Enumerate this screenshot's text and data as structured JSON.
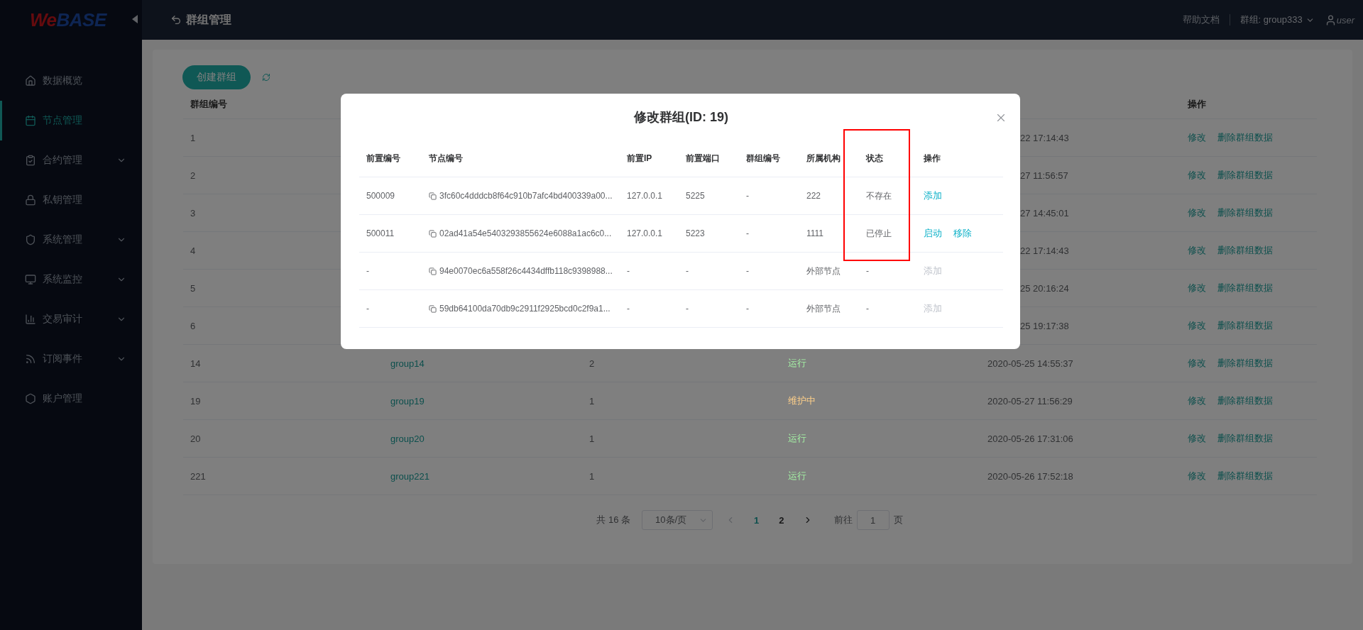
{
  "logo": [
    "We",
    "BASE"
  ],
  "sidebar": {
    "items": [
      {
        "label": "数据概览",
        "selected": false,
        "expandable": false
      },
      {
        "label": "节点管理",
        "selected": true,
        "expandable": false
      },
      {
        "label": "合约管理",
        "selected": false,
        "expandable": true
      },
      {
        "label": "私钥管理",
        "selected": false,
        "expandable": false
      },
      {
        "label": "系统管理",
        "selected": false,
        "expandable": true
      },
      {
        "label": "系统监控",
        "selected": false,
        "expandable": true
      },
      {
        "label": "交易审计",
        "selected": false,
        "expandable": true
      },
      {
        "label": "订阅事件",
        "selected": false,
        "expandable": true
      },
      {
        "label": "账户管理",
        "selected": false,
        "expandable": false
      }
    ]
  },
  "topbar": {
    "title": "群组管理",
    "help": "帮助文档",
    "group": "群组: group333",
    "user": "user"
  },
  "toolbar": {
    "create_button": "创建群组"
  },
  "table": {
    "columns": [
      "群组编号",
      null,
      null,
      null,
      null,
      "操作"
    ],
    "rows": [
      {
        "id": "1",
        "time": "22 17:14:43",
        "actions": [
          "修改",
          "删除群组数据"
        ]
      },
      {
        "id": "2",
        "time": "27 11:56:57",
        "actions": [
          "修改",
          "删除群组数据"
        ]
      },
      {
        "id": "3",
        "time": "27 14:45:01",
        "actions": [
          "修改",
          "删除群组数据"
        ]
      },
      {
        "id": "4",
        "time": "22 17:14:43",
        "actions": [
          "修改",
          "删除群组数据"
        ]
      },
      {
        "id": "5",
        "time": "25 20:16:24",
        "actions": [
          "修改",
          "删除群组数据"
        ]
      },
      {
        "id": "6",
        "time": "25 19:17:38",
        "actions": [
          "修改",
          "删除群组数据"
        ]
      },
      {
        "id": "14",
        "name": "group14",
        "nodes": "2",
        "status": "运行",
        "color": "#a4f0a4",
        "time": "2020-05-25 14:55:37",
        "actions": [
          "修改",
          "删除群组数据"
        ]
      },
      {
        "id": "19",
        "name": "group19",
        "nodes": "1",
        "status": "维护中",
        "color": "#ffd08a",
        "time": "2020-05-27 11:56:29",
        "actions": [
          "修改",
          "删除群组数据"
        ]
      },
      {
        "id": "20",
        "name": "group20",
        "nodes": "1",
        "status": "运行",
        "color": "#a4f0a4",
        "time": "2020-05-26 17:31:06",
        "actions": [
          "修改",
          "删除群组数据"
        ]
      },
      {
        "id": "221",
        "name": "group221",
        "nodes": "1",
        "status": "运行",
        "color": "#a4f0a4",
        "time": "2020-05-26 17:52:18",
        "actions": [
          "修改",
          "删除群组数据"
        ]
      }
    ]
  },
  "pagination": {
    "total": "共 16 条",
    "page_size": "10条/页",
    "pages": [
      {
        "label": "1",
        "selected": true
      },
      {
        "label": "2",
        "selected": false
      }
    ],
    "goto_label": "前往",
    "goto_value": "1",
    "goto_suffix": "页"
  },
  "dialog": {
    "title": "修改群组(ID: 19)",
    "columns": [
      {
        "label": "前置编号"
      },
      {
        "label": "节点编号"
      },
      {
        "label": "前置IP"
      },
      {
        "label": "前置端口"
      },
      {
        "label": "群组编号"
      },
      {
        "label": "所属机构"
      },
      {
        "label": "状态"
      },
      {
        "label": "操作"
      }
    ],
    "rows": [
      {
        "front_id": "500009",
        "node_id": "3fc60c4dddcb8f64c910b7afc4bd400339a00...",
        "ip": "127.0.0.1",
        "port": "5225",
        "group": "-",
        "org": "222",
        "status": "不存在",
        "actions": [
          {
            "label": "添加",
            "disabled": false
          }
        ]
      },
      {
        "front_id": "500011",
        "node_id": "02ad41a54e5403293855624e6088a1ac6c0...",
        "ip": "127.0.0.1",
        "port": "5223",
        "group": "-",
        "org": "1111",
        "status": "已停止",
        "actions": [
          {
            "label": "启动",
            "disabled": false
          },
          {
            "label": "移除",
            "disabled": false
          }
        ]
      },
      {
        "front_id": "-",
        "node_id": "94e0070ec6a558f26c4434dffb118c9398988...",
        "ip": "-",
        "port": "-",
        "group": "-",
        "org": "外部节点",
        "status": "-",
        "actions": [
          {
            "label": "添加",
            "disabled": true
          }
        ]
      },
      {
        "front_id": "-",
        "node_id": "59db64100da70db9c2911f2925bcd0c2f9a1...",
        "ip": "-",
        "port": "-",
        "group": "-",
        "org": "外部节点",
        "status": "-",
        "actions": [
          {
            "label": "添加",
            "disabled": true
          }
        ]
      }
    ]
  }
}
